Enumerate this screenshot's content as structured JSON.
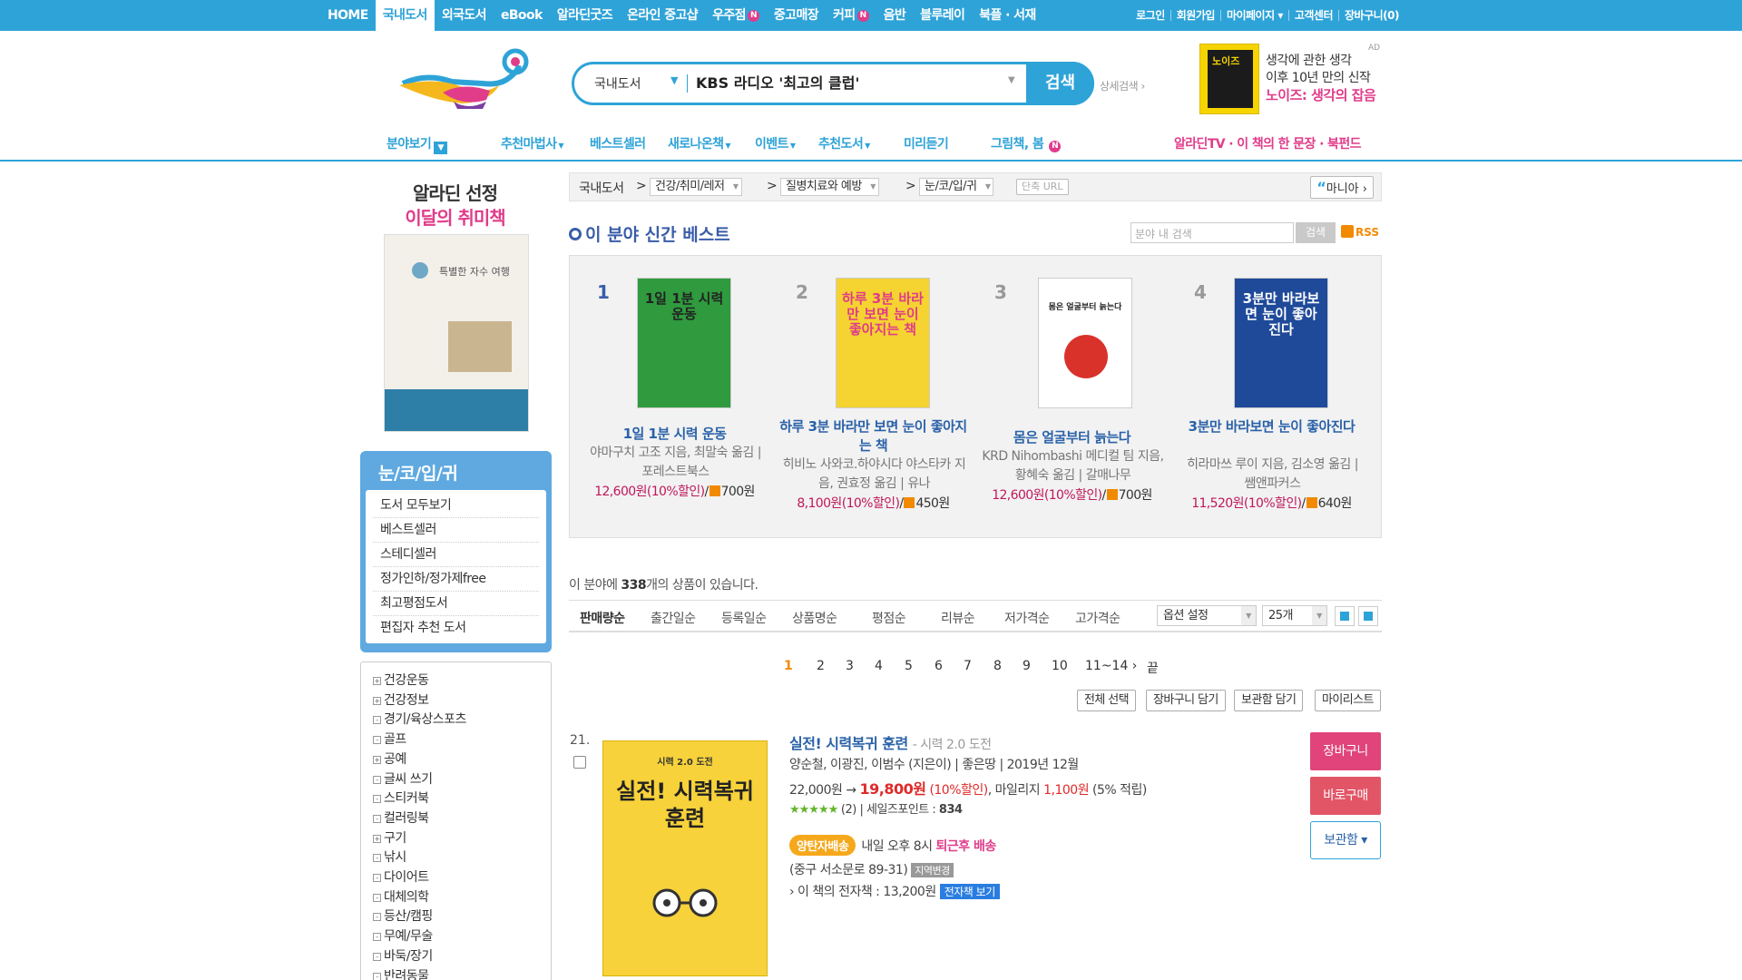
{
  "topnav": {
    "items": [
      "HOME",
      "국내도서",
      "외국도서",
      "eBook",
      "알라딘굿즈",
      "온라인 중고샵",
      "우주점",
      "중고매장",
      "커피",
      "음반",
      "블루레이",
      "북플 · 서재"
    ],
    "active_index": 1,
    "new_badge": "N",
    "right": [
      "로그인",
      "회원가입",
      "마이페이지 ▾",
      "고객센터",
      "장바구니(0)"
    ]
  },
  "search": {
    "category": "국내도서",
    "query": "KBS 라디오 '최고의 클럽'",
    "button": "검색",
    "advanced": "상세검색 ›"
  },
  "ad": {
    "label": "AD",
    "book_text": "노이즈",
    "line1": "생각에 관한 생각",
    "line2": "이후 10년 만의 신작",
    "line3": "노이즈: 생각의 잡음"
  },
  "subnav": {
    "browse": "분야보기",
    "items": [
      "추천마법사",
      "베스트셀러",
      "새로나온책",
      "이벤트",
      "추천도서",
      "미리듣기",
      "그림책, 봄"
    ],
    "right": "알라딘TV · 이 책의 한 문장 · 북펀드"
  },
  "promo": {
    "line1": "알라딘 선정",
    "line2": "이달의 취미책",
    "cover_title": "특별한 자수 여행"
  },
  "category_box": {
    "title": "눈/코/입/귀",
    "items": [
      "도서 모두보기",
      "베스트셀러",
      "스테디셀러",
      "정가인하/정가제free",
      "최고평점도서",
      "편집자 추천 도서"
    ]
  },
  "tree": {
    "items": [
      {
        "label": "건강운동",
        "mark": "+"
      },
      {
        "label": "건강정보",
        "mark": "+"
      },
      {
        "label": "경기/육상스포츠",
        "mark": "-"
      },
      {
        "label": "골프",
        "mark": "-"
      },
      {
        "label": "공예",
        "mark": "+"
      },
      {
        "label": "글씨 쓰기",
        "mark": "-"
      },
      {
        "label": "스티커북",
        "mark": "-"
      },
      {
        "label": "컬러링북",
        "mark": "-"
      },
      {
        "label": "구기",
        "mark": "+"
      },
      {
        "label": "낚시",
        "mark": "-"
      },
      {
        "label": "다이어트",
        "mark": "-"
      },
      {
        "label": "대체의학",
        "mark": "-"
      },
      {
        "label": "등산/캠핑",
        "mark": "-"
      },
      {
        "label": "무예/무술",
        "mark": "-"
      },
      {
        "label": "바둑/장기",
        "mark": "-"
      },
      {
        "label": "반려동물",
        "mark": "-"
      }
    ]
  },
  "breadcrumb": {
    "root": "국내도서",
    "level1": "건강/취미/레저",
    "level2": "질병치료와 예방",
    "level3": "눈/코/입/귀",
    "short_url": "단축 URL",
    "mania": "마니아"
  },
  "best": {
    "heading": "이 분야 신간 베스트",
    "search_placeholder": "분야 내 검색",
    "search_button": "검색",
    "rss": "RSS",
    "items": [
      {
        "rank": "1",
        "title": "1일 1분 시력 운동",
        "author": "야마구치 고조 지음, 최말숙 옮김 | 포레스트북스",
        "price": "12,600원",
        "discount": "(10%할인)",
        "mileage": "700원",
        "cover_text": "1일 1분 시력 운동",
        "cover_color": "#2f9a3e"
      },
      {
        "rank": "2",
        "title": "하루 3분 바라만 보면 눈이 좋아지는 책",
        "author": "히비노 사와코.하야시다 야스타카 지음, 권효정 옮김 | 유나",
        "price": "8,100원",
        "discount": "(10%할인)",
        "mileage": "450원",
        "cover_text": "하루 3분 바라만 보면 눈이 좋아지는 책",
        "cover_color": "#f5d330"
      },
      {
        "rank": "3",
        "title": "몸은 얼굴부터 늙는다",
        "author": "KRD Nihombashi 메디컬 팀 지음, 황혜숙 옮김 | 갈매나무",
        "price": "12,600원",
        "discount": "(10%할인)",
        "mileage": "700원",
        "cover_text": "몸은 얼굴부터 늙는다",
        "cover_color": "#ffffff"
      },
      {
        "rank": "4",
        "title": "3분만 바라보면 눈이 좋아진다",
        "author": "히라마쓰 루이 지음, 김소영 옮김 | 쌤앤파커스",
        "price": "11,520원",
        "discount": "(10%할인)",
        "mileage": "640원",
        "cover_text": "3분만 바라보면 눈이 좋아진다",
        "cover_color": "#1f4a9a"
      }
    ]
  },
  "listing": {
    "count_text_pre": "이 분야에 ",
    "count": "338",
    "count_text_post": "개의 상품이 있습니다.",
    "sorts": [
      "판매량순",
      "출간일순",
      "등록일순",
      "상품명순",
      "평점순",
      "리뷰순",
      "저가격순",
      "고가격순"
    ],
    "active_sort": 0,
    "option_select": "옵션 설정",
    "per_page": "25개",
    "pages": [
      "1",
      "2",
      "3",
      "4",
      "5",
      "6",
      "7",
      "8",
      "9",
      "10",
      "11~14 ›",
      "끝"
    ],
    "active_page": 0,
    "actions": [
      "전체 선택",
      "장바구니 담기",
      "보관함 담기",
      "마이리스트"
    ]
  },
  "product": {
    "num": "21.",
    "title": "실전! 시력복귀 훈련",
    "subtitle": "- 시력 2.0 도전",
    "meta": "양순철, 이광진, 이범수 (지은이) | 좋은땅 | 2019년 12월",
    "list_price": "22,000원 →",
    "sale_price": "19,800원",
    "discount": "(10%할인)",
    "mileage_label": ", 마일리지",
    "mileage": "1,100원",
    "mileage_rate": "(5% 적립)",
    "stars": "★★★★★",
    "rating_text": "(2) | 세일즈포인트 :",
    "salespoint": "834",
    "ship_badge": "양탄자배송",
    "ship_text": "내일 오후 8시",
    "ship_hl": "퇴근후 배송",
    "address": "(중구 서소문로 89-31)",
    "address_change": "지역변경",
    "ebook_text": "› 이 책의 전자책 : 13,200원",
    "ebook_button": "전자책 보기",
    "cover_tag": "시력 2.0 도전",
    "cover_title": "실전! 시력복귀 훈련",
    "btn_cart": "장바구니",
    "btn_buy": "바로구매",
    "btn_keep": "보관함 ▾"
  }
}
